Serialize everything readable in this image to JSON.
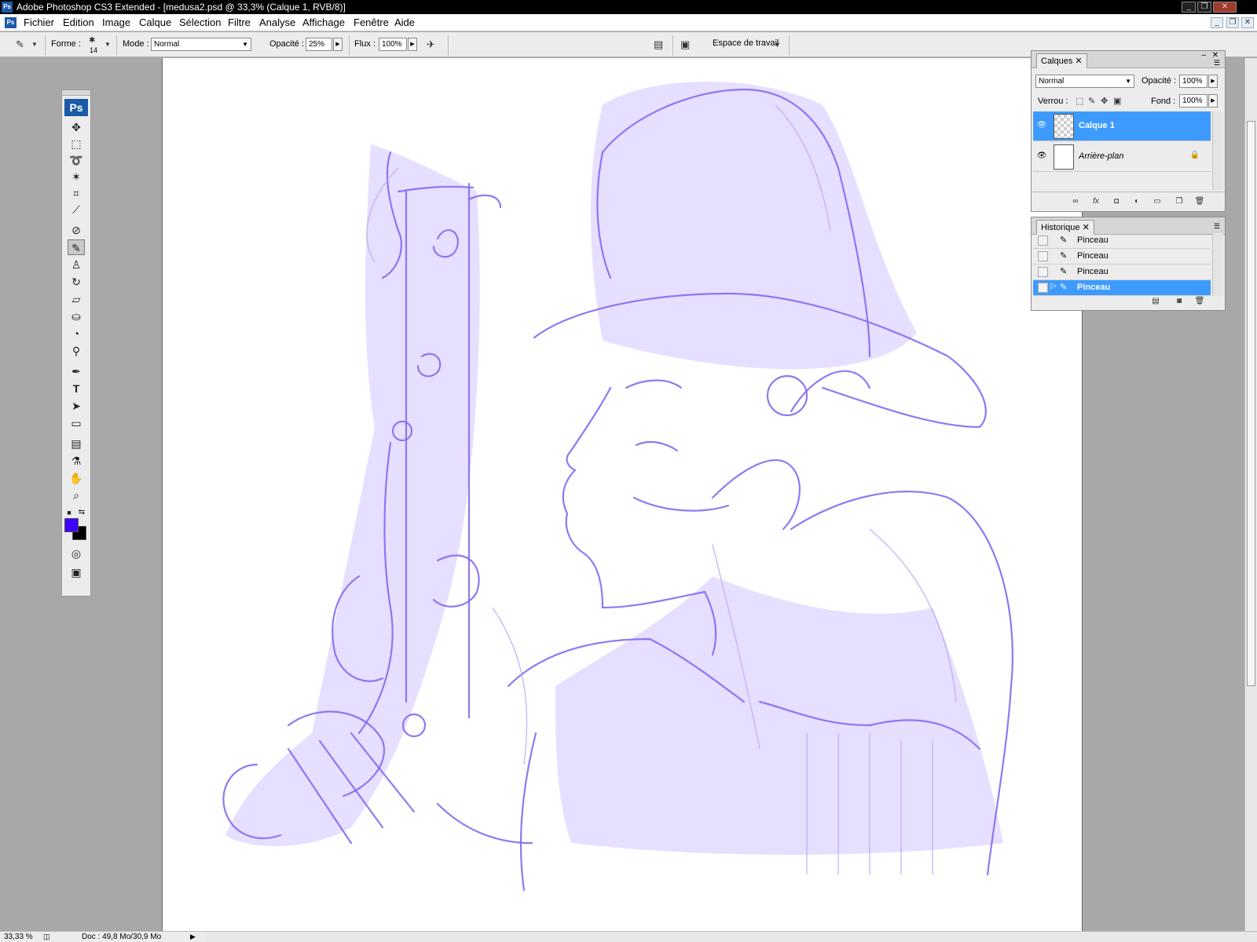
{
  "window": {
    "title": "Adobe Photoshop CS3 Extended - [medusa2.psd @ 33,3% (Calque 1, RVB/8)]"
  },
  "menu": [
    "Fichier",
    "Edition",
    "Image",
    "Calque",
    "Sélection",
    "Filtre",
    "Analyse",
    "Affichage",
    "Fenêtre",
    "Aide"
  ],
  "options": {
    "forme_label": "Forme :",
    "brush_size": "14",
    "mode_label": "Mode :",
    "mode_value": "Normal",
    "opacite_label": "Opacité :",
    "opacite_value": "25%",
    "flux_label": "Flux :",
    "flux_value": "100%",
    "workspace_label": "Espace de travail"
  },
  "toolbox": {
    "logo": "Ps",
    "foreground_color": "#3f00ff",
    "background_color": "#000000"
  },
  "layers_panel": {
    "tab": "Calques",
    "blend_mode": "Normal",
    "opacity_label": "Opacité :",
    "opacity_value": "100%",
    "lock_label": "Verrou :",
    "fill_label": "Fond :",
    "fill_value": "100%",
    "layers": [
      {
        "name": "Calque 1",
        "selected": true
      },
      {
        "name": "Arrière-plan",
        "selected": false,
        "locked": true
      }
    ]
  },
  "history_panel": {
    "tab": "Historique",
    "items": [
      "Pinceau",
      "Pinceau",
      "Pinceau",
      "Pinceau"
    ]
  },
  "status": {
    "zoom": "33,33 %",
    "doc": "Doc : 49,8 Mo/30,9 Mo"
  },
  "icons": [
    "brush-icon",
    "move-tool-icon",
    "marquee-tool-icon",
    "lasso-tool-icon",
    "magic-wand-icon",
    "crop-tool-icon",
    "slice-tool-icon",
    "healing-brush-icon",
    "brush-tool-icon",
    "clone-stamp-icon",
    "history-brush-icon",
    "eraser-icon",
    "paint-bucket-icon",
    "blur-tool-icon",
    "dodge-tool-icon",
    "pen-tool-icon",
    "type-tool-icon",
    "path-select-icon",
    "shape-tool-icon",
    "notes-tool-icon",
    "eyedropper-icon",
    "hand-tool-icon",
    "zoom-tool-icon",
    "quick-mask-icon",
    "screen-mode-icon",
    "eye-icon",
    "lock-icon"
  ]
}
